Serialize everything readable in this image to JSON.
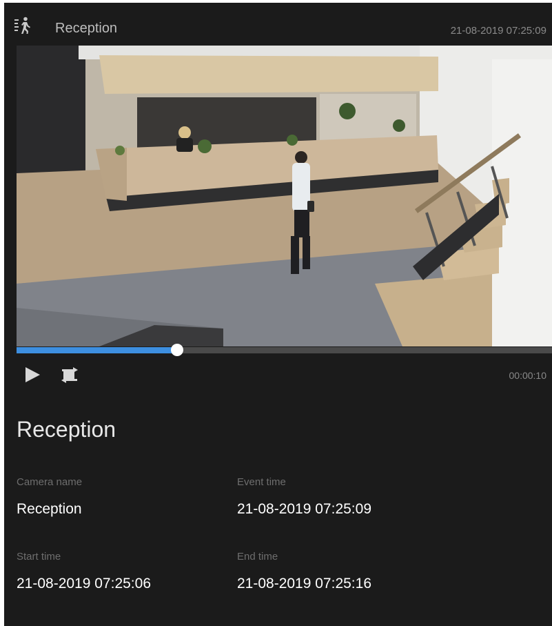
{
  "header": {
    "icon": "motion-walking-person-icon",
    "camera_title": "Reception",
    "timestamp": "21-08-2019 07:25:09"
  },
  "video": {
    "description_icon": "camera-video-frame",
    "playback_progress": 0.3
  },
  "controls": {
    "play_icon": "play-icon",
    "loop_icon": "loop-icon",
    "duration": "00:00:10"
  },
  "details": {
    "title": "Reception",
    "camera_name_label": "Camera name",
    "camera_name_value": "Reception",
    "event_time_label": "Event time",
    "event_time_value": "21-08-2019 07:25:09",
    "start_time_label": "Start time",
    "start_time_value": "21-08-2019 07:25:06",
    "end_time_label": "End time",
    "end_time_value": "21-08-2019 07:25:16"
  },
  "colors": {
    "panel_bg": "#1b1b1b",
    "progress_accent": "#3d8fe0",
    "label_gray": "#6e6e6e"
  }
}
